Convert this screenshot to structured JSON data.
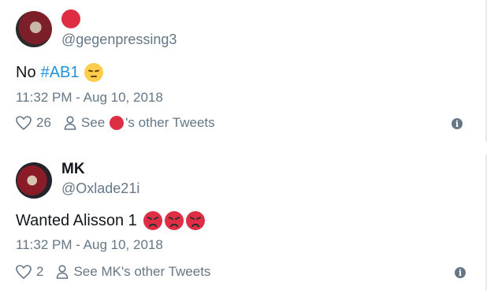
{
  "colors": {
    "text": "#14171a",
    "secondary": "#657786",
    "link": "#1b95e0",
    "red_avatar": "#dd2e44"
  },
  "tweets": [
    {
      "handle": "@gegenpressing3",
      "text": "No",
      "hashtag": "#AB1",
      "emoji": "pensive-face",
      "timestamp": "11:32 PM - Aug 10, 2018",
      "like_count": "26",
      "see_prefix": "See",
      "see_suffix": "'s other Tweets"
    },
    {
      "name": "MK",
      "handle": "@Oxlade21i",
      "text": "Wanted Alisson 1",
      "emojis": [
        "pouting-face",
        "pouting-face",
        "pouting-face"
      ],
      "timestamp": "11:32 PM - Aug 10, 2018",
      "like_count": "2",
      "see_text": "See MK's other Tweets"
    }
  ]
}
